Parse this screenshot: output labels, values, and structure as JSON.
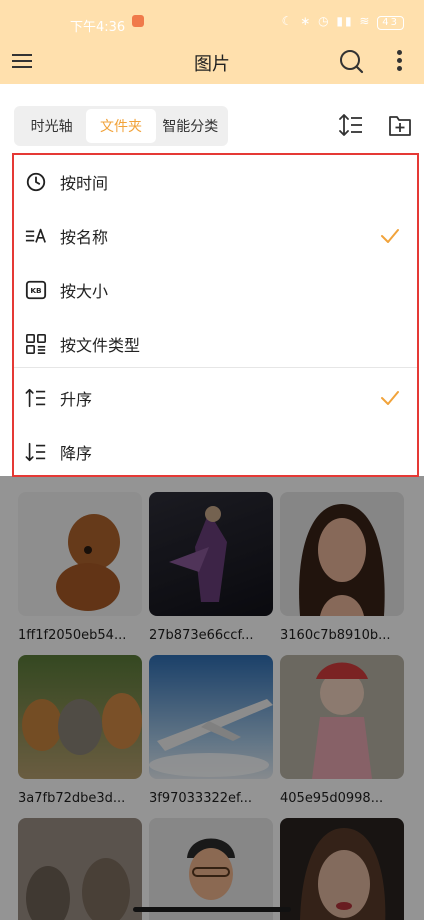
{
  "status_bar": {
    "time": "下午4:36",
    "icons": "☾ ∗ ◷ ▮▮ ≋",
    "battery": "43"
  },
  "header": {
    "title": "图片"
  },
  "tabs": [
    {
      "label": "时光轴",
      "active": false
    },
    {
      "label": "文件夹",
      "active": true
    },
    {
      "label": "智能分类",
      "active": false
    }
  ],
  "sort_menu": {
    "options": [
      {
        "label": "按时间",
        "icon": "clock-icon",
        "checked": false
      },
      {
        "label": "按名称",
        "icon": "sort-name-icon",
        "checked": true
      },
      {
        "label": "按大小",
        "icon": "kb-icon",
        "checked": false
      },
      {
        "label": "按文件类型",
        "icon": "file-type-grid-icon",
        "checked": false
      }
    ],
    "order": [
      {
        "label": "升序",
        "icon": "ascending-icon",
        "checked": true
      },
      {
        "label": "降序",
        "icon": "descending-icon",
        "checked": false
      }
    ]
  },
  "grid": {
    "items": [
      {
        "caption": "1ff1f2050eb54...",
        "subject": "poodle-dog"
      },
      {
        "caption": "27b873e66ccf...",
        "subject": "fantasy-character"
      },
      {
        "caption": "3160c7b8910b...",
        "subject": "woman-portrait"
      },
      {
        "caption": "3a7fb72dbe3d...",
        "subject": "kittens"
      },
      {
        "caption": "3f97033322ef...",
        "subject": "airplane"
      },
      {
        "caption": "405e95d0998...",
        "subject": "opera-figurine"
      },
      {
        "caption": "",
        "subject": "cats"
      },
      {
        "caption": "",
        "subject": "cartoon-man"
      },
      {
        "caption": "",
        "subject": "woman-face"
      }
    ]
  },
  "colors": {
    "header_bg": "#ffe0ad",
    "accent": "#f1a33b",
    "highlight_border": "#e53935"
  }
}
